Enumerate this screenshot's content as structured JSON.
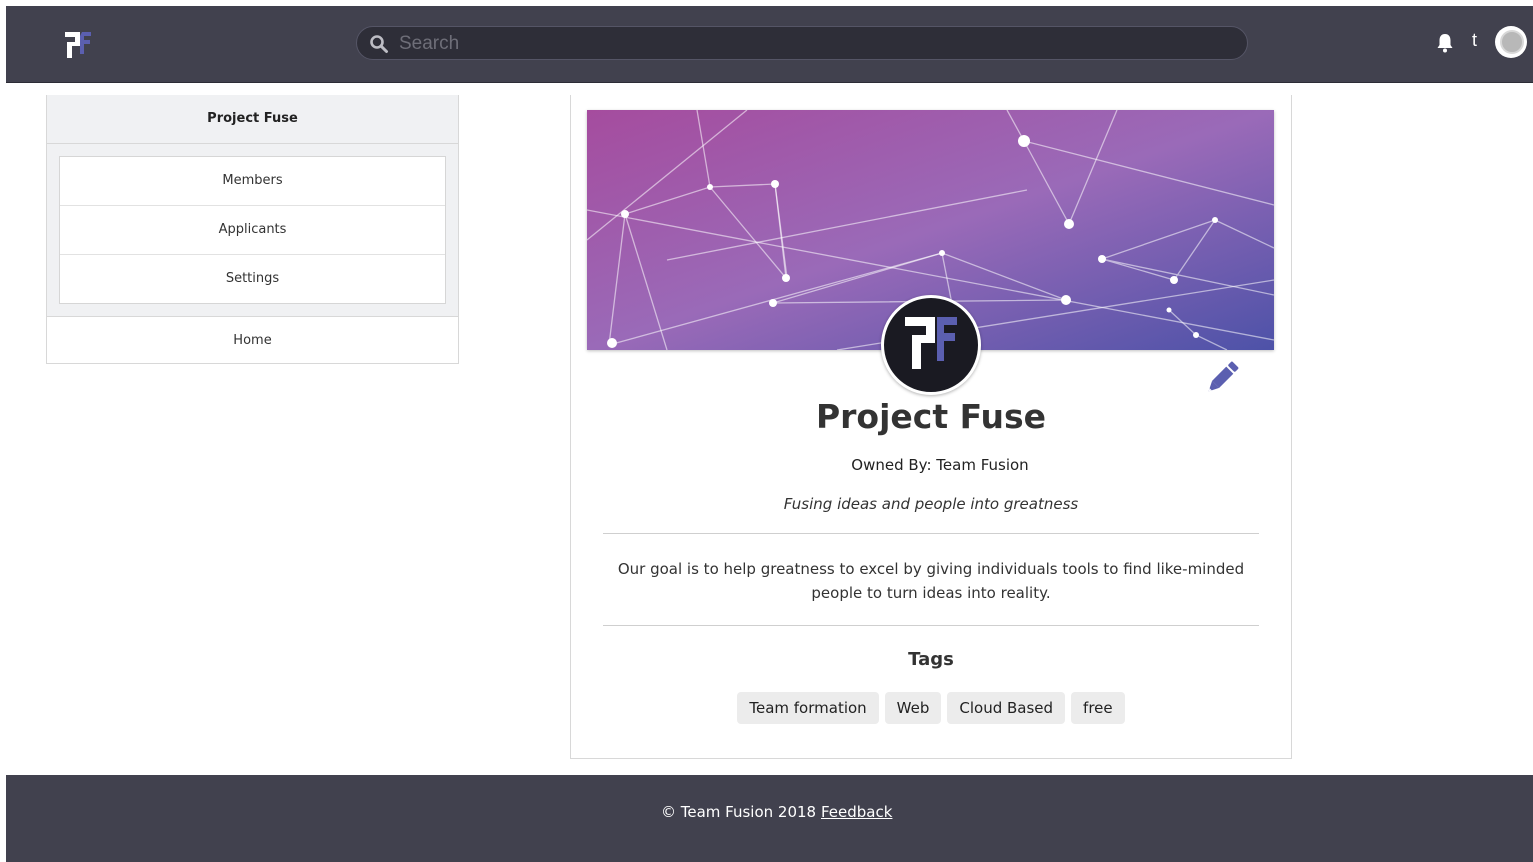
{
  "header": {
    "logo_icon": "project-fuse-logo-icon",
    "search_placeholder": "Search",
    "search_icon": "search-icon",
    "bell_icon": "bell-icon",
    "user_initial": "t"
  },
  "sidebar": {
    "title": "Project Fuse",
    "items": [
      {
        "label": "Members"
      },
      {
        "label": "Applicants"
      },
      {
        "label": "Settings"
      }
    ],
    "home_label": "Home"
  },
  "project": {
    "name": "Project Fuse",
    "owner_text": "Owned By: Team Fusion",
    "tagline": "Fusing ideas and people into greatness",
    "description": "Our goal is to help greatness to excel by giving individuals tools to find like-minded people to turn ideas into reality.",
    "tags_heading": "Tags",
    "tags": [
      "Team formation",
      "Web",
      "Cloud Based",
      "free"
    ],
    "edit_icon": "pencil-icon"
  },
  "footer": {
    "copyright": "© Team Fusion 2018",
    "feedback_label": "Feedback"
  },
  "colors": {
    "navbar": "#41414e",
    "accent": "#5b5fb0",
    "banner_start": "#a54c9e",
    "banner_end": "#4d52a8"
  }
}
